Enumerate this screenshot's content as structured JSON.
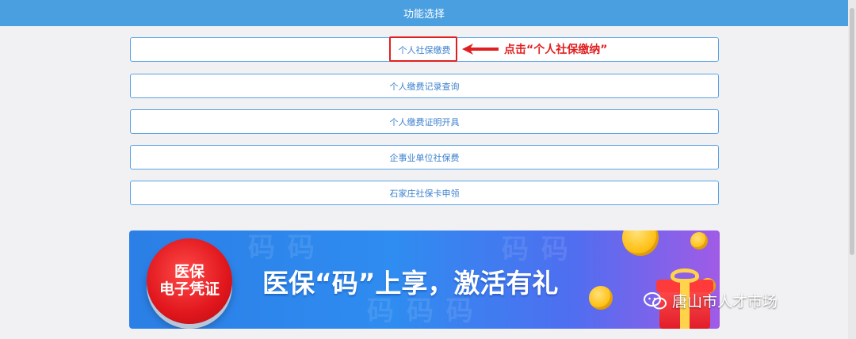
{
  "header": {
    "title": "功能选择"
  },
  "menu": {
    "items": [
      {
        "label": "个人社保缴费"
      },
      {
        "label": "个人缴费记录查询"
      },
      {
        "label": "个人缴费证明开具"
      },
      {
        "label": "企事业单位社保费"
      },
      {
        "label": "石家庄社保卡申领"
      }
    ]
  },
  "annotation": {
    "text": "点击“个人社保缴纳”",
    "color": "#e02020"
  },
  "banner": {
    "badge_line1": "医保",
    "badge_line2": "电子凭证",
    "headline": "医保“码”上享，激活有礼"
  },
  "watermark": {
    "text": "唐山市人才市场"
  },
  "colors": {
    "topbar": "#4a9fe0",
    "button_border": "#5aa3e6",
    "button_text": "#3f83cf",
    "highlight": "#e02020"
  }
}
